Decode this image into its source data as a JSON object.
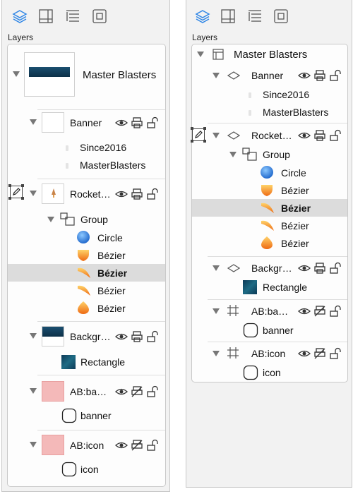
{
  "section_label": "Layers",
  "toolbar": {
    "icons": [
      "layers-icon",
      "canvas-icon",
      "outline-icon",
      "selection-icon"
    ]
  },
  "left": {
    "rows": [
      {
        "label": "Master Blasters"
      },
      {
        "label": "Banner"
      },
      {
        "label": "Since2016"
      },
      {
        "label": "MasterBlasters"
      },
      {
        "label": "Rocket…"
      },
      {
        "label": "Group"
      },
      {
        "label": "Circle"
      },
      {
        "label": "Bézier"
      },
      {
        "label": "Bézier"
      },
      {
        "label": "Bézier"
      },
      {
        "label": "Bézier"
      },
      {
        "label": "Backgr…"
      },
      {
        "label": "Rectangle"
      },
      {
        "label": "AB:ba…"
      },
      {
        "label": "banner"
      },
      {
        "label": "AB:icon"
      },
      {
        "label": "icon"
      }
    ]
  },
  "right": {
    "rows": [
      {
        "label": "Master Blasters"
      },
      {
        "label": "Banner"
      },
      {
        "label": "Since2016"
      },
      {
        "label": "MasterBlasters"
      },
      {
        "label": "Rocket…"
      },
      {
        "label": "Group"
      },
      {
        "label": "Circle"
      },
      {
        "label": "Bézier"
      },
      {
        "label": "Bézier"
      },
      {
        "label": "Bézier"
      },
      {
        "label": "Bézier"
      },
      {
        "label": "Backgr…"
      },
      {
        "label": "Rectangle"
      },
      {
        "label": "AB:ba…"
      },
      {
        "label": "banner"
      },
      {
        "label": "AB:icon"
      },
      {
        "label": "icon"
      }
    ]
  },
  "colors": {
    "accent": "#2f86e6",
    "selected_row": "#dcdcdc",
    "artboard_fill": "#f4b9b9"
  }
}
